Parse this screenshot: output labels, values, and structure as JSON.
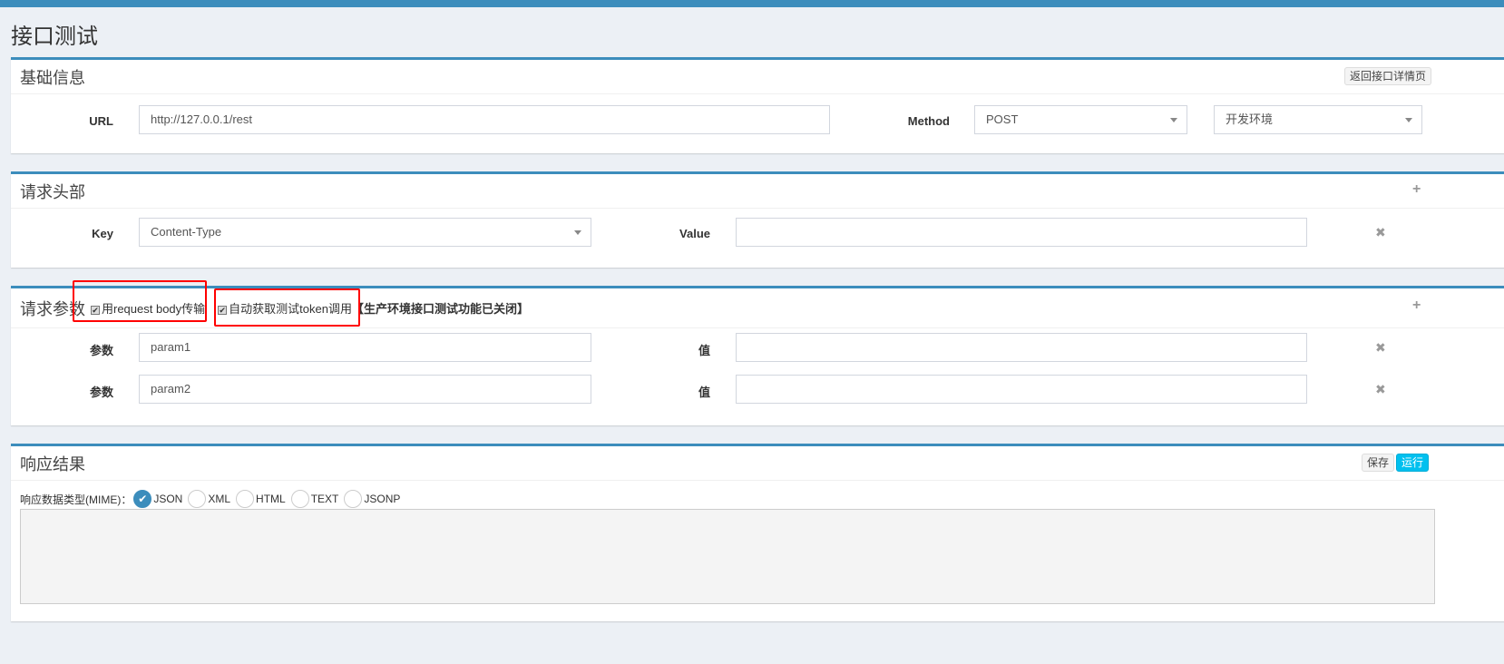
{
  "page_title": "接口测试",
  "basic": {
    "title": "基础信息",
    "back_button": "返回接口详情页",
    "url_label": "URL",
    "url_value": "http://127.0.0.1/rest",
    "method_label": "Method",
    "method_value": "POST",
    "env_value": "开发环境"
  },
  "headers": {
    "title": "请求头部",
    "add": "+",
    "key_label": "Key",
    "key_value": "Content-Type",
    "value_label": "Value",
    "value_value": "",
    "remove": "✖"
  },
  "params": {
    "title": "请求参数",
    "check_body": "用request body传输",
    "check_token": "自动获取测试token调用",
    "notice": "【生产环境接口测试功能已关闭】",
    "add": "+",
    "rows": [
      {
        "label": "参数",
        "name": "param1",
        "value_label": "值",
        "value": "",
        "remove": "✖"
      },
      {
        "label": "参数",
        "name": "param2",
        "value_label": "值",
        "value": "",
        "remove": "✖"
      }
    ]
  },
  "response": {
    "title": "响应结果",
    "save": "保存",
    "run": "运行",
    "mime_label": "响应数据类型(MIME)：",
    "mime_options": [
      "JSON",
      "XML",
      "HTML",
      "TEXT",
      "JSONP"
    ],
    "selected": "JSON",
    "body": ""
  },
  "colors": {
    "accent": "#3c8dbc",
    "highlight": "#ff0000",
    "run": "#00c0ef"
  }
}
